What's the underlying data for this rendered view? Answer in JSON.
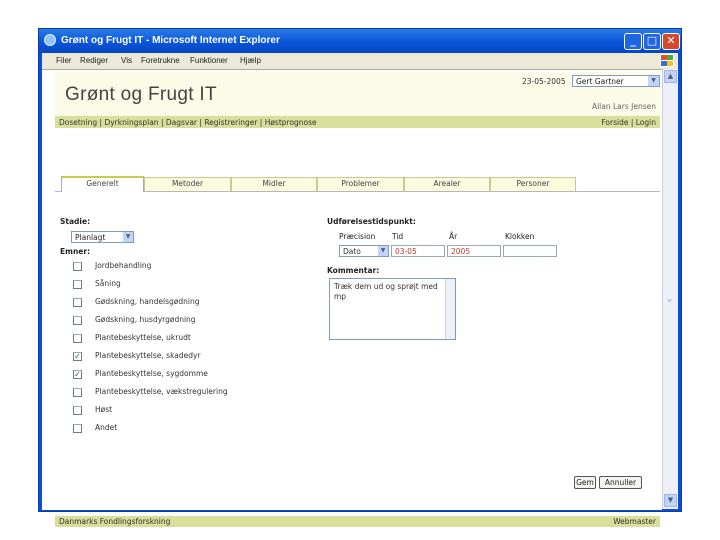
{
  "window": {
    "title": "Grønt og Frugt IT - Microsoft Internet Explorer",
    "minimize": "_",
    "maximize": "□",
    "close": "✕"
  },
  "menu": [
    "Filer",
    "Rediger",
    "Vis",
    "Foretrukne",
    "Funktioner",
    "Hjælp"
  ],
  "header": {
    "brand": "Grønt og Frugt IT",
    "date": "23-05-2005",
    "user_select": "Gert Gartner",
    "alt_user": "Allan Lars Jensen",
    "nav_left": "Dosetning | Dyrkningsplan | Dagsvar | Registreringer | Høstprognose",
    "nav_right": "Forside | Login"
  },
  "tabs": [
    "Generelt",
    "Metoder",
    "Midler",
    "Problemer",
    "Arealer",
    "Personer"
  ],
  "form": {
    "stadie_label": "Stadie:",
    "stadie_value": "Planlagt",
    "emner_label": "Emner:",
    "emner": [
      {
        "label": "Jordbehandling",
        "checked": false
      },
      {
        "label": "Såning",
        "checked": false
      },
      {
        "label": "Gødskning, handelsgødning",
        "checked": false
      },
      {
        "label": "Gødskning, husdyrgødning",
        "checked": false
      },
      {
        "label": "Plantebeskyttelse, ukrudt",
        "checked": false
      },
      {
        "label": "Plantebeskyttelse, skadedyr",
        "checked": true
      },
      {
        "label": "Plantebeskyttelse, sygdomme",
        "checked": true
      },
      {
        "label": "Plantebeskyttelse, vækstregulering",
        "checked": false
      },
      {
        "label": "Høst",
        "checked": false
      },
      {
        "label": "Andet",
        "checked": false
      }
    ],
    "udf_label": "Udførelsestidspunkt:",
    "col_precision": "Præcision",
    "col_tid": "Tid",
    "col_aar": "År",
    "col_klokken": "Klokken",
    "precision_value": "Dato",
    "tid_value": "03-05",
    "aar_value": "2005",
    "klokken_value": "",
    "kommentar_label": "Kommentar:",
    "kommentar_value": "Træk dem ud og sprøjt med mp",
    "gem_button": "Gem",
    "annuller_button": "Annuller"
  },
  "footer": {
    "left": "Danmarks Fondlingsforskning",
    "right": "Webmaster"
  }
}
